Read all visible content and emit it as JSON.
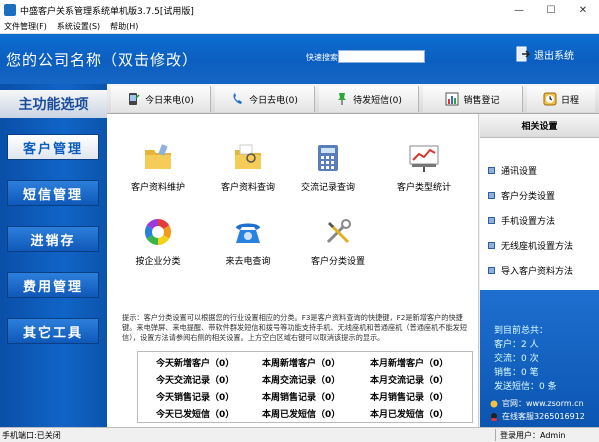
{
  "window": {
    "title": "中盛客户关系管理系统单机版3.7.5[试用版]",
    "minimize": "—",
    "maximize": "☐",
    "close": "✕"
  },
  "menu": [
    "文件管理(F)",
    "系统设置(S)",
    "帮助(H)"
  ],
  "header": {
    "company_name": "您的公司名称（双击修改）",
    "quick_search_label": "快速搜索",
    "quick_search_value": "",
    "exit_label": "退出系统"
  },
  "sidebar": {
    "heading": "主功能选项",
    "items": [
      "客户管理",
      "短信管理",
      "进销存",
      "费用管理",
      "其它工具"
    ],
    "active_index": 0
  },
  "tabs": [
    "今日来电(0)",
    "今日去电(0)",
    "待发短信(0)",
    "销售登记",
    "日程"
  ],
  "functions": [
    {
      "label": "客户资料维护",
      "icon": "folder-edit-icon"
    },
    {
      "label": "客户资料查询",
      "icon": "folder-search-icon"
    },
    {
      "label": "交流记录查询",
      "icon": "calculator-icon"
    },
    {
      "label": "客户类型统计",
      "icon": "presentation-chart-icon"
    },
    {
      "label": "按企业分类",
      "icon": "color-wheel-icon"
    },
    {
      "label": "来去电查询",
      "icon": "telephone-icon"
    },
    {
      "label": "客户分类设置",
      "icon": "tools-icon"
    }
  ],
  "hint": "提示：客户分类设置可以根据您的行业设置相应的分类。F3是客户资料查询的快捷键，F2是新增客户的快捷键。来电弹屏、来电提醒、带软件群发短信和拨号等功能支持手机、无线座机和普通座机（普通座机不能发短信），设置方法请参阅右侧的相关设置。上方空白区域右键可以取消该提示的显示。",
  "stats": [
    [
      "今天新增客户（0）",
      "本周新增客户（0）",
      "本月新增客户（0）"
    ],
    [
      "今天交流记录（0）",
      "本周交流记录（0）",
      "本月交流记录（0）"
    ],
    [
      "今天销售记录（0）",
      "本周销售记录（0）",
      "本月销售记录（0）"
    ],
    [
      "今天已发短信（0）",
      "本周已发短信（0）",
      "本月已发短信（0）"
    ]
  ],
  "right_panel": {
    "heading": "相关设置",
    "items": [
      "通讯设置",
      "客户分类设置",
      "手机设置方法",
      "无线座机设置方法",
      "导入客户资料方法"
    ],
    "summary_title": "到目前总共：",
    "summary_lines": [
      "客户：2 人",
      "交流：0 次",
      "销售：0 笔",
      "发送短信：0 条"
    ],
    "website": "官网：www.zsorm.cn",
    "qq": "在线客服3265016912"
  },
  "status": {
    "left": "手机端口:已关闭",
    "right": "登录用户：Admin"
  },
  "colors": {
    "header_blue": "#0b5ec0",
    "sidebar_blue": "#1064c7"
  }
}
